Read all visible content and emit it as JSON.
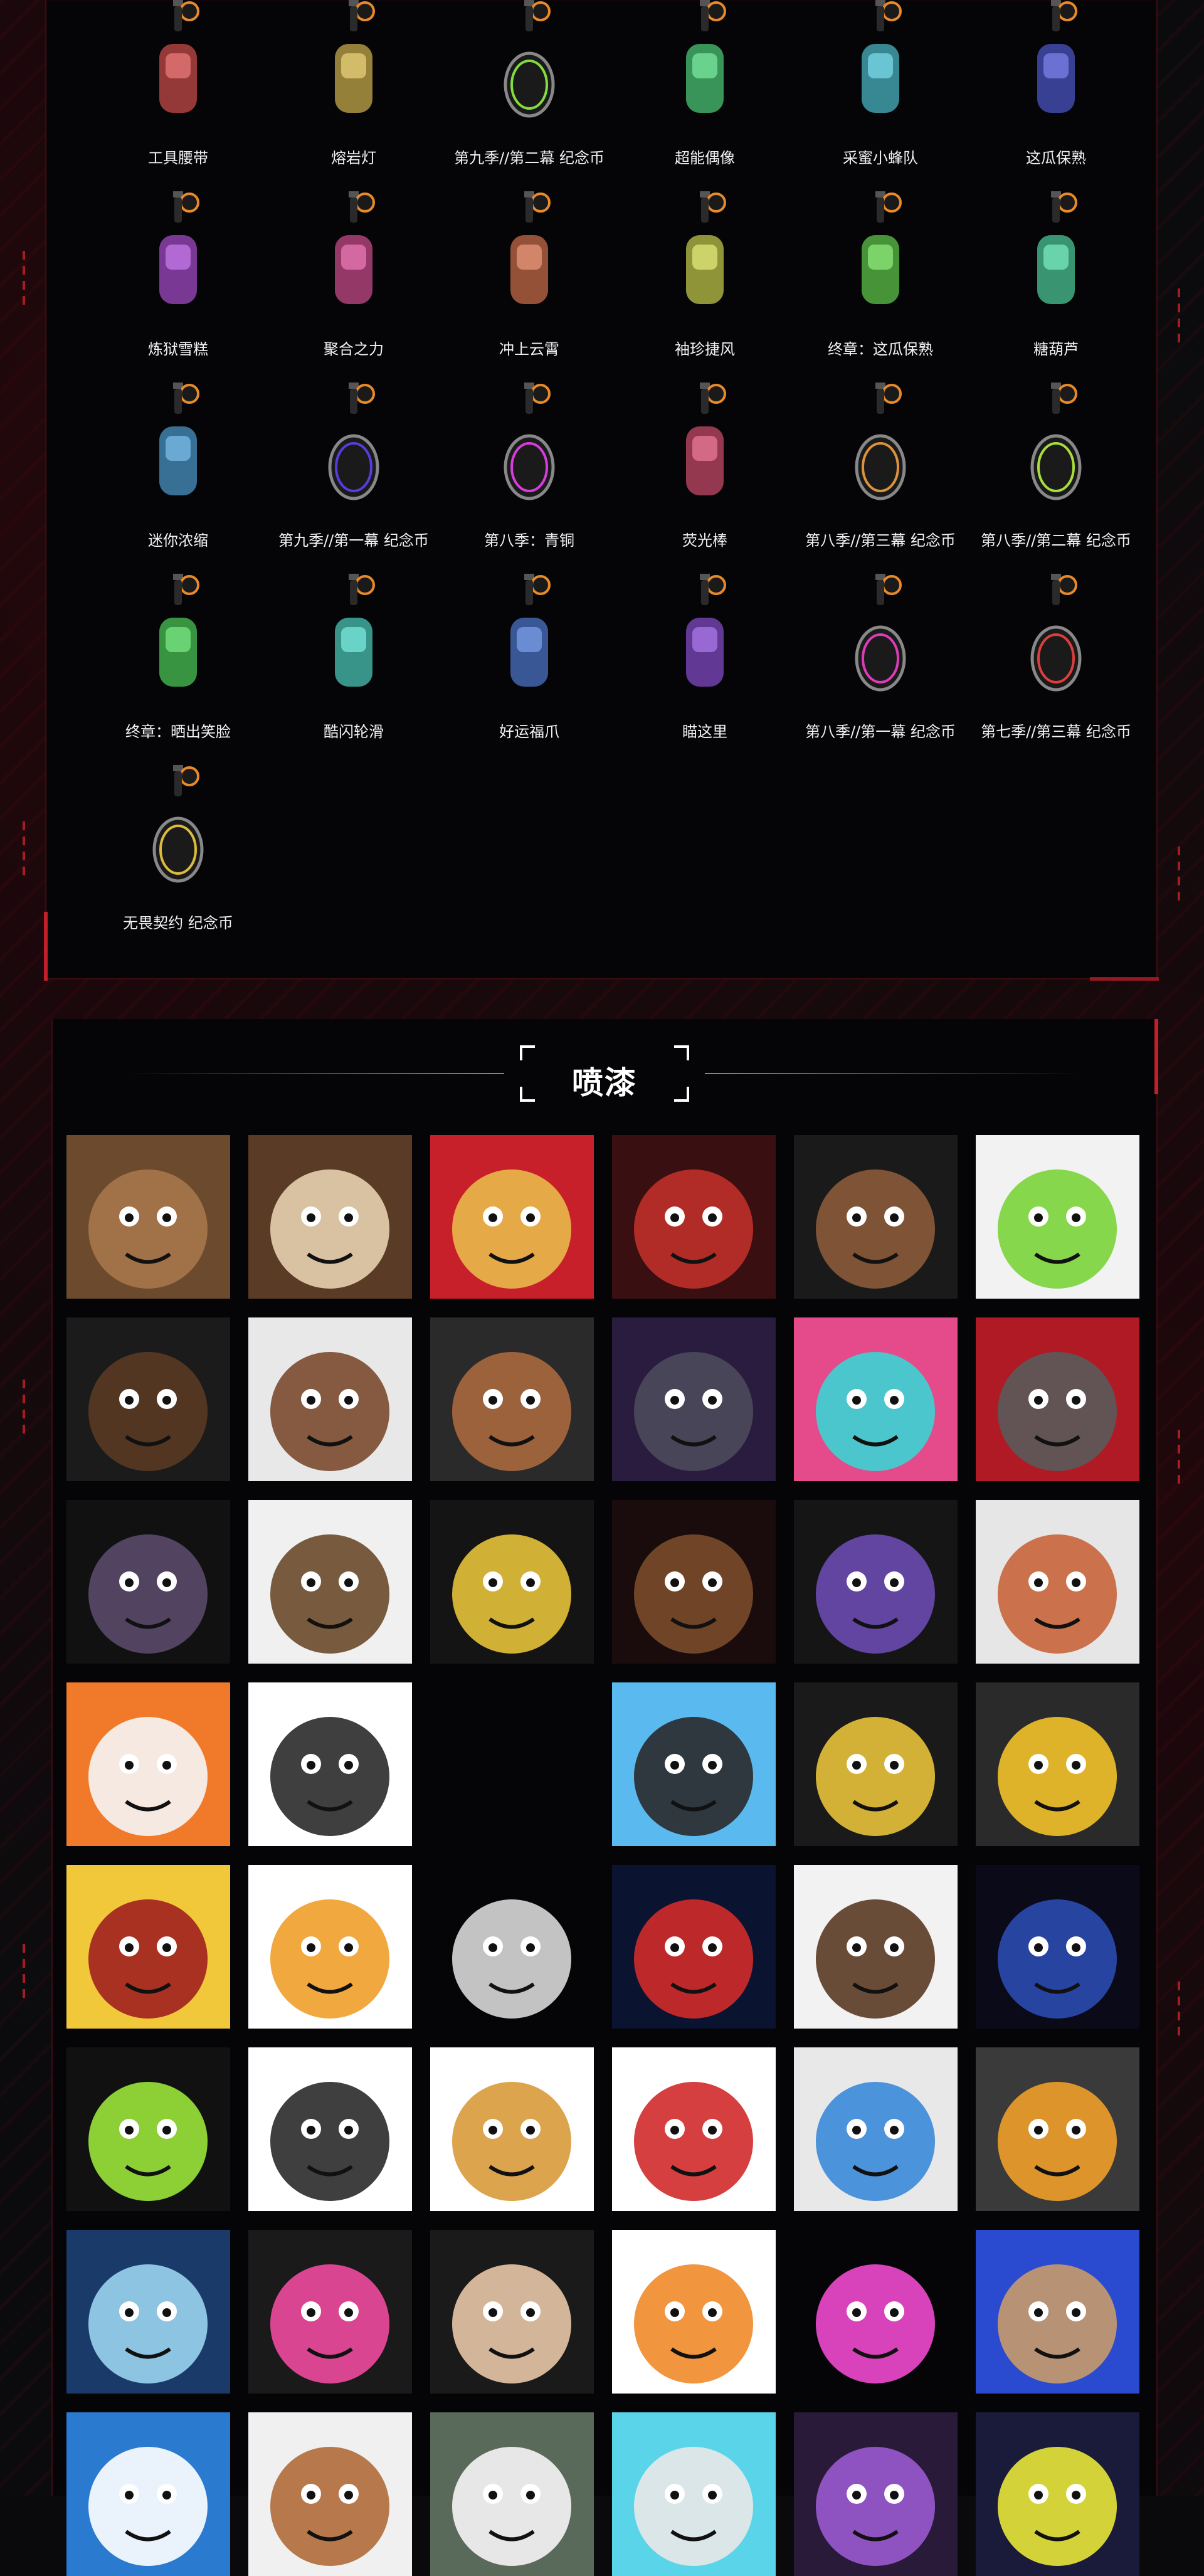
{
  "buddies": {
    "items": [
      {
        "label": "工具腰带",
        "icon": "tool-belt-charm-icon"
      },
      {
        "label": "熔岩灯",
        "icon": "lava-lamp-charm-icon"
      },
      {
        "label": "第九季//第二幕 纪念币",
        "icon": "ep9-act2-coin-icon"
      },
      {
        "label": "超能偶像",
        "icon": "idol-charm-icon"
      },
      {
        "label": "采蜜小蜂队",
        "icon": "beehive-charm-icon"
      },
      {
        "label": "这瓜保熟",
        "icon": "watermelon-charm-icon"
      },
      {
        "label": "炼狱雪糕",
        "icon": "popsicle-charm-icon"
      },
      {
        "label": "聚合之力",
        "icon": "drop-charm-icon"
      },
      {
        "label": "冲上云霄",
        "icon": "hot-air-balloon-charm-icon"
      },
      {
        "label": "袖珍捷风",
        "icon": "jett-figure-charm-icon"
      },
      {
        "label": "终章：这瓜保熟",
        "icon": "melon-slice-charm-icon"
      },
      {
        "label": "糖葫芦",
        "icon": "candied-haws-charm-icon"
      },
      {
        "label": "迷你浓缩",
        "icon": "espresso-machine-charm-icon"
      },
      {
        "label": "第九季//第一幕 纪念币",
        "icon": "ep9-act1-coin-icon"
      },
      {
        "label": "第八季：青铜",
        "icon": "ep8-bronze-icon"
      },
      {
        "label": "荧光棒",
        "icon": "glowstick-charm-icon"
      },
      {
        "label": "第八季//第三幕 纪念币",
        "icon": "ep8-act3-coin-icon"
      },
      {
        "label": "第八季//第二幕 纪念币",
        "icon": "ep8-act2-coin-icon"
      },
      {
        "label": "终章：晒出笑脸",
        "icon": "frying-pan-charm-icon"
      },
      {
        "label": "酷闪轮滑",
        "icon": "roller-skate-charm-icon"
      },
      {
        "label": "好运福爪",
        "icon": "lucky-paw-charm-icon"
      },
      {
        "label": "瞄这里",
        "icon": "target-charm-icon"
      },
      {
        "label": "第八季//第一幕 纪念币",
        "icon": "ep8-act1-coin-icon"
      },
      {
        "label": "第七季//第三幕 纪念币",
        "icon": "ep7-act3-coin-icon"
      },
      {
        "label": "无畏契约 纪念币",
        "icon": "valorant-coin-icon"
      }
    ]
  },
  "sprays": {
    "title": "喷漆",
    "items": [
      {
        "icon": "bear-sunglasses-spray-icon",
        "bg": "#6b4a2e",
        "fg": "#a7764a"
      },
      {
        "icon": "squirrel-spray-icon",
        "bg": "#5a3b26",
        "fg": "#e7d2b0"
      },
      {
        "icon": "golden-horse-spray-icon",
        "bg": "#c8202a",
        "fg": "#e9b84a"
      },
      {
        "icon": "red-mech-spray-icon",
        "bg": "#3a0f12",
        "fg": "#c0302a"
      },
      {
        "icon": "muscle-arm-spray-icon",
        "bg": "#1a1a1a",
        "fg": "#8a5a3a"
      },
      {
        "icon": "green-slime-spray-icon",
        "bg": "#f2f2f2",
        "fg": "#7ad43a"
      },
      {
        "icon": "dreadlocks-spray-icon",
        "bg": "#1b1b1b",
        "fg": "#5a3a24"
      },
      {
        "icon": "headphones-agent-spray-icon",
        "bg": "#e8e8e8",
        "fg": "#7a4a2e"
      },
      {
        "icon": "smirk-face-spray-icon",
        "bg": "#2a2a2a",
        "fg": "#a8683e"
      },
      {
        "icon": "dark-robot-spray-icon",
        "bg": "#2a1c3e",
        "fg": "#4a4a5a"
      },
      {
        "icon": "pink-star-spray-icon",
        "bg": "#e54a8a",
        "fg": "#3ad4d4"
      },
      {
        "icon": "red-crack-spray-icon",
        "bg": "#b01a24",
        "fg": "#5a5a5a"
      },
      {
        "icon": "claws-spray-icon",
        "bg": "#111111",
        "fg": "#5a4a6a"
      },
      {
        "icon": "angry-agent-spray-icon",
        "bg": "#f0f0f0",
        "fg": "#6a4a2a"
      },
      {
        "icon": "purple-glasses-spray-icon",
        "bg": "#141414",
        "fg": "#e4c23a"
      },
      {
        "icon": "shouting-face-spray-icon",
        "bg": "#1a0c0c",
        "fg": "#7a4a2a"
      },
      {
        "icon": "purple-lightning-star-spray-icon",
        "bg": "#151515",
        "fg": "#6a4ab0"
      },
      {
        "icon": "bearded-agent-spray-icon",
        "bg": "#e6e6e6",
        "fg": "#c8643a"
      },
      {
        "icon": "tiger-teeth-spray-icon",
        "bg": "#f07a2a",
        "fg": "#f5f5f5"
      },
      {
        "icon": "glasses-girl-spray-icon",
        "bg": "#ffffff",
        "fg": "#2a2a2a"
      },
      {
        "icon": "empty-spray-slot",
        "bg": "#050507",
        "fg": "#050507"
      },
      {
        "icon": "bear-penguin-spray-icon",
        "bg": "#5abaf0",
        "fg": "#2a2a2a"
      },
      {
        "icon": "black-gold-crown-spray-icon",
        "bg": "#1a1a1a",
        "fg": "#e8c23a"
      },
      {
        "icon": "cheese-spray-icon",
        "bg": "#2a2a2a",
        "fg": "#f2c22a"
      },
      {
        "icon": "fist-bump-spray-icon",
        "bg": "#f0c83a",
        "fg": "#a02020"
      },
      {
        "icon": "duck-sunglasses-spray-icon",
        "bg": "#ffffff",
        "fg": "#f0a02a"
      },
      {
        "icon": "suave-agent-spray-icon",
        "bg": "#050507",
        "fg": "#d8d8d8"
      },
      {
        "icon": "red-eyes-spray-icon",
        "bg": "#0a1430",
        "fg": "#d02a2a"
      },
      {
        "icon": "coffee-cup-spray-icon",
        "bg": "#f2f2f2",
        "fg": "#5a3a24"
      },
      {
        "icon": "blue-dragon-spray-icon",
        "bg": "#0a0a18",
        "fg": "#2a4ab0"
      },
      {
        "icon": "green-hex-spray-icon",
        "bg": "#111111",
        "fg": "#9ae63a"
      },
      {
        "icon": "rifles-spray-icon",
        "bg": "#ffffff",
        "fg": "#2a2a2a"
      },
      {
        "icon": "bullet-spray-icon",
        "bg": "#ffffff",
        "fg": "#d89a3a"
      },
      {
        "icon": "birthday-candle-spray-icon",
        "bg": "#ffffff",
        "fg": "#d02a2a"
      },
      {
        "icon": "blue-sigil-spray-icon",
        "bg": "#e8e8e8",
        "fg": "#3a8ad8"
      },
      {
        "icon": "dark-mask-spray-icon",
        "bg": "#3a3a3a",
        "fg": "#f0a02a"
      },
      {
        "icon": "blue-fighter-spray-icon",
        "bg": "#1a3a6a",
        "fg": "#9ad4f0"
      },
      {
        "icon": "pink-blob-spray-icon",
        "bg": "#1a1a1a",
        "fg": "#f04aa0"
      },
      {
        "icon": "smug-face-spray-icon",
        "bg": "#1a1a1a",
        "fg": "#e8c8a8"
      },
      {
        "icon": "lucky-tiger-spray-icon",
        "bg": "#ffffff",
        "fg": "#f08a2a"
      },
      {
        "icon": "pink-orb-spray-icon",
        "bg": "#050507",
        "fg": "#f04ad0"
      },
      {
        "icon": "blue-hair-agent-spray-icon",
        "bg": "#2a4ad0",
        "fg": "#c89a6a"
      },
      {
        "icon": "shocked-face-spray-icon",
        "bg": "#2a7ad0",
        "fg": "#ffffff"
      },
      {
        "icon": "frown-face-spray-icon",
        "bg": "#f0f0f0",
        "fg": "#b06a3a"
      },
      {
        "icon": "hooded-agent-spray-icon",
        "bg": "#5a6a5a",
        "fg": "#f5f5f5"
      },
      {
        "icon": "goggles-agent-spray-icon",
        "bg": "#5ad4e8",
        "fg": "#e8e8e8"
      },
      {
        "icon": "purple-hair-spray-icon",
        "bg": "#2a1a3a",
        "fg": "#9a5ad0"
      },
      {
        "icon": "yellow-emblem-spray-icon",
        "bg": "#1a1a3a",
        "fg": "#e8e83a"
      }
    ]
  },
  "colors": {
    "background": "#0a0a0c",
    "panel": "#050507",
    "accent_red": "#c0202a",
    "text": "#f2f2f2"
  }
}
